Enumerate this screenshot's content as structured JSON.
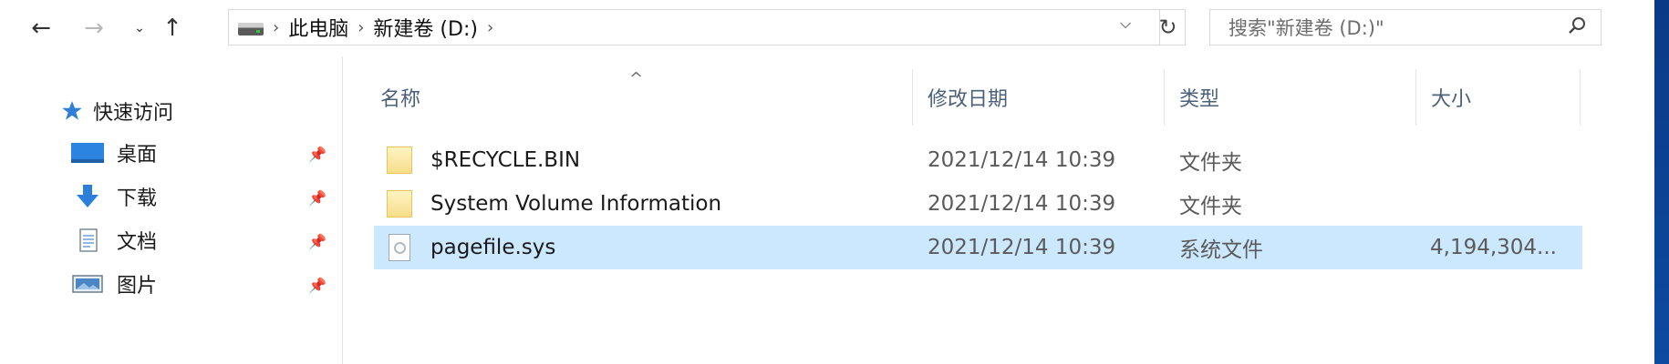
{
  "nav": {
    "back_icon": "arrow-left-icon",
    "forward_icon": "arrow-right-icon",
    "recent_icon": "chevron-down-icon",
    "up_icon": "arrow-up-icon"
  },
  "address": {
    "crumbs": [
      "此电脑",
      "新建卷 (D:)"
    ]
  },
  "search": {
    "placeholder": "搜索\"新建卷 (D:)\""
  },
  "sidebar": {
    "quick_access": "快速访问",
    "items": [
      {
        "label": "桌面",
        "icon": "desktop-icon"
      },
      {
        "label": "下载",
        "icon": "download-icon"
      },
      {
        "label": "文档",
        "icon": "documents-icon"
      },
      {
        "label": "图片",
        "icon": "pictures-icon"
      }
    ]
  },
  "columns": {
    "name": "名称",
    "modified": "修改日期",
    "type": "类型",
    "size": "大小"
  },
  "files": [
    {
      "name": "$RECYCLE.BIN",
      "modified": "2021/12/14 10:39",
      "type": "文件夹",
      "size": "",
      "icon": "folder-icon"
    },
    {
      "name": "System Volume Information",
      "modified": "2021/12/14 10:39",
      "type": "文件夹",
      "size": "",
      "icon": "folder-icon"
    },
    {
      "name": "pagefile.sys",
      "modified": "2021/12/14 10:39",
      "type": "系统文件",
      "size": "4,194,304...",
      "icon": "system-file-icon",
      "selected": true
    }
  ],
  "colors": {
    "selection": "#cce8ff",
    "header_text": "#4c607a",
    "desktop": "#0b3f8e"
  }
}
